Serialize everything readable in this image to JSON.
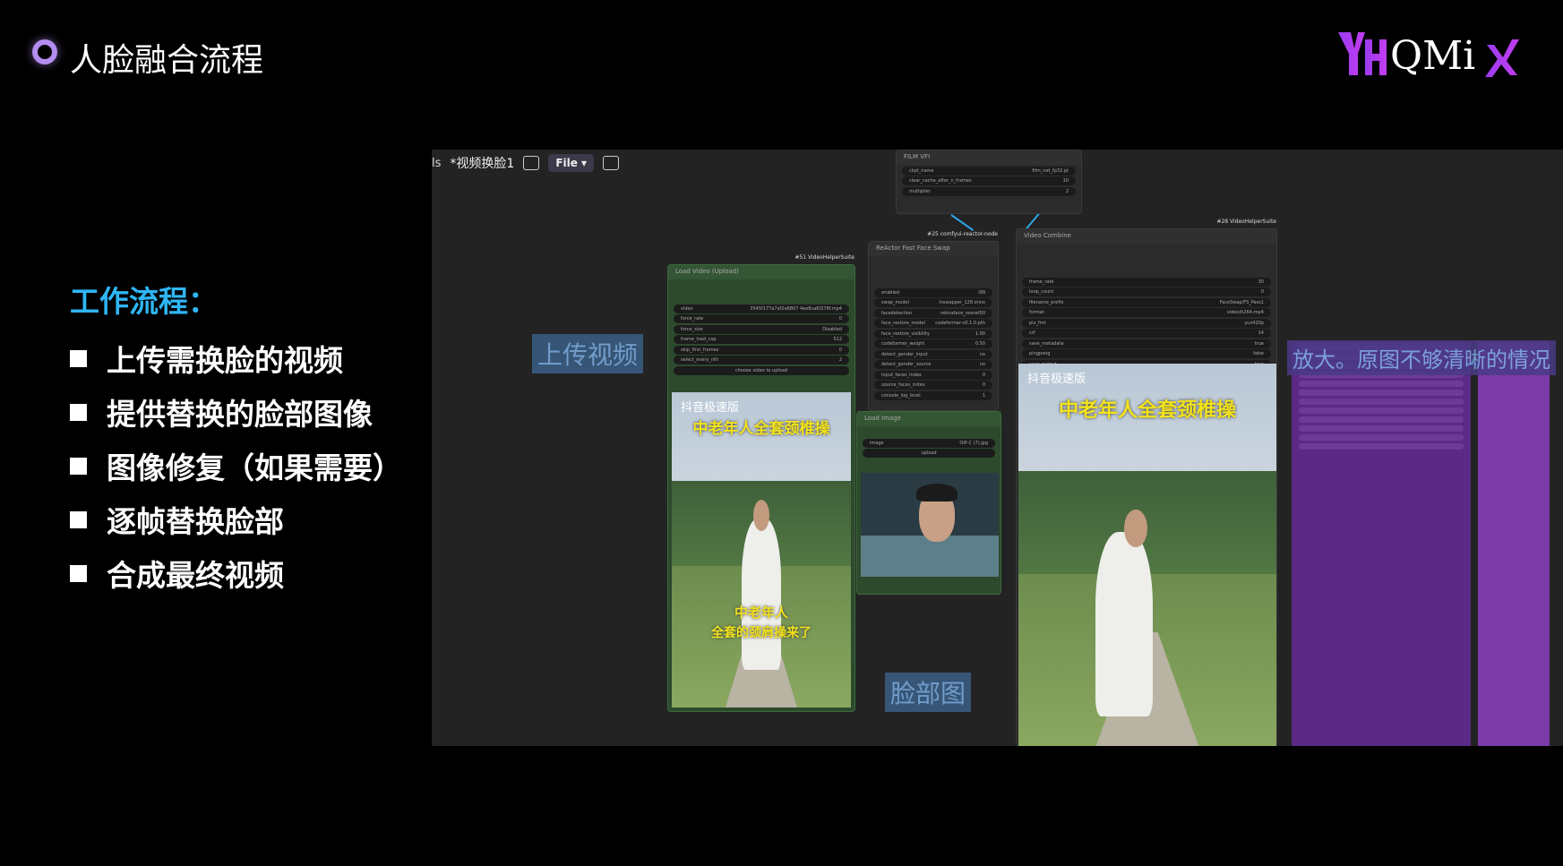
{
  "slide": {
    "title": "人脸融合流程",
    "logo_text": "QMix",
    "logo_mark": "YH",
    "section_heading": "工作流程：",
    "bullets": [
      "上传需换脸的视频",
      "提供替换的脸部图像",
      "图像修复（如果需要）",
      "逐帧替换脸部",
      "合成最终视频"
    ]
  },
  "app": {
    "tab_fragment": "ls",
    "tab_title": "*视频换脸1",
    "file_menu": "File",
    "nodes": {
      "film_vfi": {
        "title": "FILM VFI",
        "rows": [
          [
            "ckpt_name",
            "film_net_fp32.pt"
          ],
          [
            "clear_cache_after_n_frames",
            "10"
          ],
          [
            "multiplier",
            "2"
          ]
        ]
      },
      "load_video": {
        "tag": "#51 VideoHelperSuite",
        "title": "Load Video (Upload)",
        "rows": [
          [
            "video",
            "3545f177a7af2e6807 4ee8ca6f278f.mp4"
          ],
          [
            "force_rate",
            "0"
          ],
          [
            "force_size",
            "Disabled"
          ],
          [
            "frame_load_cap",
            "512"
          ],
          [
            "skip_first_frames",
            "0"
          ],
          [
            "select_every_nth",
            "2"
          ]
        ],
        "upload_button": "choose video to upload"
      },
      "reactor": {
        "tag": "#25 comfyui-reactor-node",
        "title": "ReActor Fast Face Swap",
        "rows": [
          [
            "enabled",
            "ON"
          ],
          [
            "swap_model",
            "inswapper_128.onnx"
          ],
          [
            "facedetection",
            "retinaface_resnet50"
          ],
          [
            "face_restore_model",
            "codeformer-v0.1.0.pth"
          ],
          [
            "face_restore_visibility",
            "1.00"
          ],
          [
            "codeformer_weight",
            "0.50"
          ],
          [
            "detect_gender_input",
            "no"
          ],
          [
            "detect_gender_source",
            "no"
          ],
          [
            "input_faces_index",
            "0"
          ],
          [
            "source_faces_index",
            "0"
          ],
          [
            "console_log_level",
            "1"
          ]
        ]
      },
      "load_image": {
        "title": "Load Image",
        "rows": [
          [
            "image",
            "OIP-C (7).jpg"
          ]
        ],
        "upload_button": "upload"
      },
      "video_combine": {
        "tag": "#28 VideoHelperSuite",
        "title": "Video Combine",
        "rows": [
          [
            "frame_rate",
            "30"
          ],
          [
            "loop_count",
            "0"
          ],
          [
            "filename_prefix",
            "FaceSwap/FS_Pass1"
          ],
          [
            "format",
            "video/h264-mp4"
          ],
          [
            "pix_fmt",
            "yuv420p"
          ],
          [
            "crf",
            "14"
          ],
          [
            "save_metadata",
            "true"
          ],
          [
            "pingpong",
            "false"
          ],
          [
            "save_output",
            "true"
          ]
        ]
      }
    },
    "overlay_labels": {
      "upload_video": "上传视频",
      "face_image": "脸部图",
      "upscale_note": "放大。原图不够清晰的情况"
    },
    "video_captions": {
      "brand": "抖音极速版",
      "headline": "中老年人全套颈椎操",
      "sub_line1": "中老年人",
      "sub_line2": "全套的颈肩操来了"
    },
    "colors": {
      "accent_heading": "#2eb6f5",
      "node_green": "#2d4a2d",
      "group_purple": "#5a2a85",
      "wire_blue": "#2fa6e6"
    }
  }
}
